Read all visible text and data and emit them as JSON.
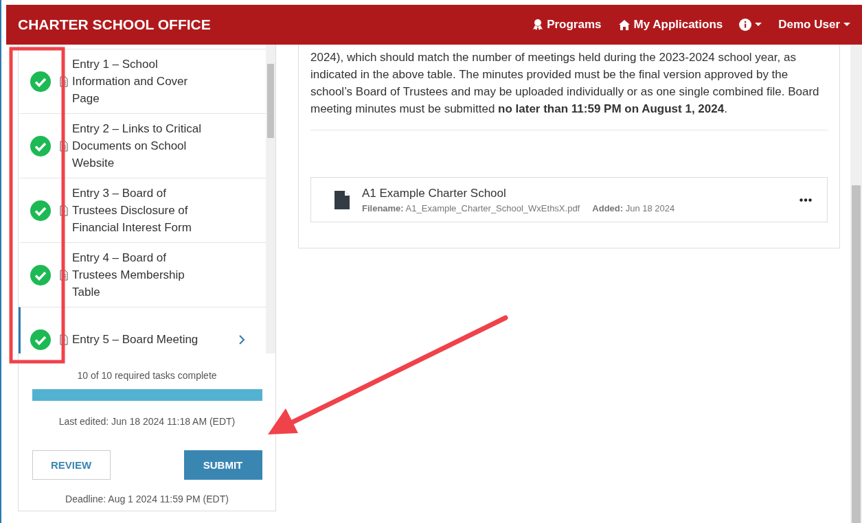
{
  "header": {
    "title": "CHARTER SCHOOL OFFICE",
    "nav": [
      {
        "kind": "programs",
        "label": "Programs"
      },
      {
        "kind": "home",
        "label": "My Applications"
      },
      {
        "kind": "info"
      },
      {
        "kind": "user",
        "label": "Demo User"
      }
    ]
  },
  "sidebar": {
    "entries": [
      {
        "title": "Entry 1 – School Information and Cover Page",
        "kind": "document",
        "complete": true,
        "selected": false
      },
      {
        "title": "Entry 2 – Links to Critical Documents on School Website",
        "kind": "document",
        "complete": true,
        "selected": false
      },
      {
        "title": "Entry 3 – Board of Trustees Disclosure of Financial Interest Form",
        "kind": "upload",
        "complete": true,
        "selected": false
      },
      {
        "title": "Entry 4 – Board of Trustees Membership Table",
        "kind": "document",
        "complete": true,
        "selected": false
      },
      {
        "title": "Entry 5 – Board Meeting",
        "kind": "upload",
        "complete": true,
        "selected": true
      }
    ],
    "progress_text": "10 of 10 required tasks complete",
    "progress": {
      "level": 1
    },
    "last_edited": "Last edited: Jun 18 2024 11:18 AM (EDT)",
    "buttons": [
      {
        "kind": "secondary",
        "label": "REVIEW"
      },
      {
        "kind": "primary",
        "label": "SUBMIT"
      }
    ],
    "deadline": "Deadline: Aug 1 2024 11:59 PM (EDT)"
  },
  "content": {
    "paragraph": "2024), which should match the number of meetings held during the 2023-2024 school year, as indicated in the above table. The minutes provided must be the final version approved by the school’s Board of Trustees and may be uploaded individually or as one single combined file. Board meeting minutes must be submitted **no later than 11:59 PM on August 1, 2024**.",
    "file": {
      "name": "A1 Example Charter School",
      "filename_label": "Filename:",
      "filename": "A1_Example_Charter_School_WxEthsX.pdf",
      "added_label": "Added:",
      "added": "Jun 18 2024"
    }
  }
}
